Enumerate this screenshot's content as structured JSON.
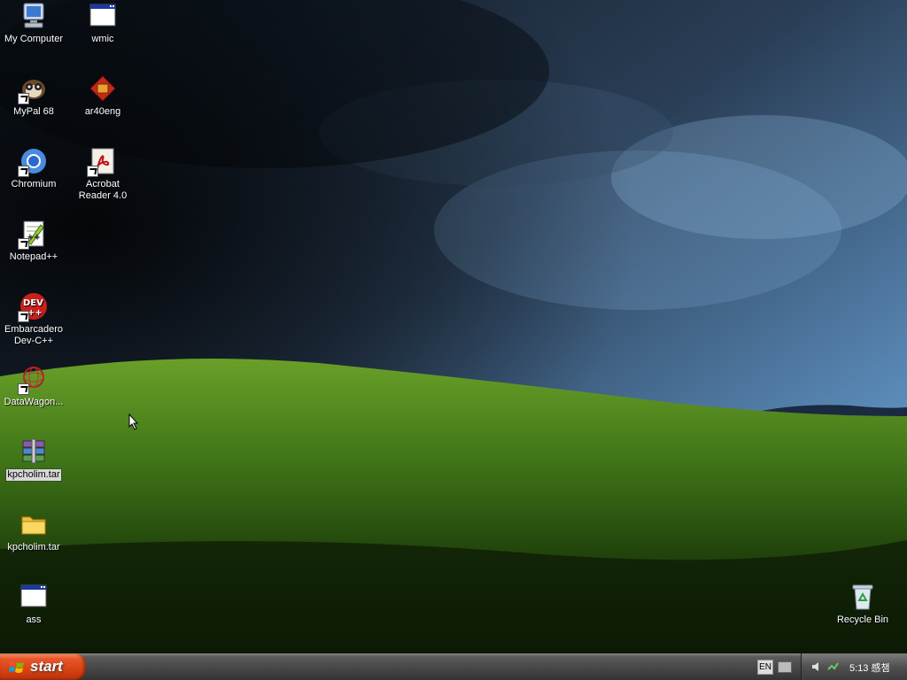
{
  "desktop": {
    "icons": [
      {
        "label": "My Computer",
        "glyph": "my-computer-icon"
      },
      {
        "label": "wmic",
        "glyph": "console-window-icon"
      },
      {
        "label": "MyPal 68",
        "glyph": "mypal-browser-icon"
      },
      {
        "label": "ar40eng",
        "glyph": "installer-icon"
      },
      {
        "label": "Chromium",
        "glyph": "chromium-icon"
      },
      {
        "label": "Acrobat Reader 4.0",
        "glyph": "acrobat-icon"
      },
      {
        "label": "Notepad++",
        "glyph": "notepad-plus-plus-icon"
      },
      {
        "label": "Embarcadero Dev-C++",
        "glyph": "dev-cpp-icon"
      },
      {
        "label": "DataWagon...",
        "glyph": "datawagon-icon"
      },
      {
        "label": "kpcholim.tar",
        "glyph": "winrar-archive-icon"
      },
      {
        "label": "kpcholim.tar",
        "glyph": "folder-icon"
      },
      {
        "label": "ass",
        "glyph": "console-window-icon"
      },
      {
        "label": "Recycle Bin",
        "glyph": "recycle-bin-icon"
      }
    ]
  },
  "taskbar": {
    "start_label": "start",
    "language": "EN",
    "clock": "5:13 感챔"
  }
}
